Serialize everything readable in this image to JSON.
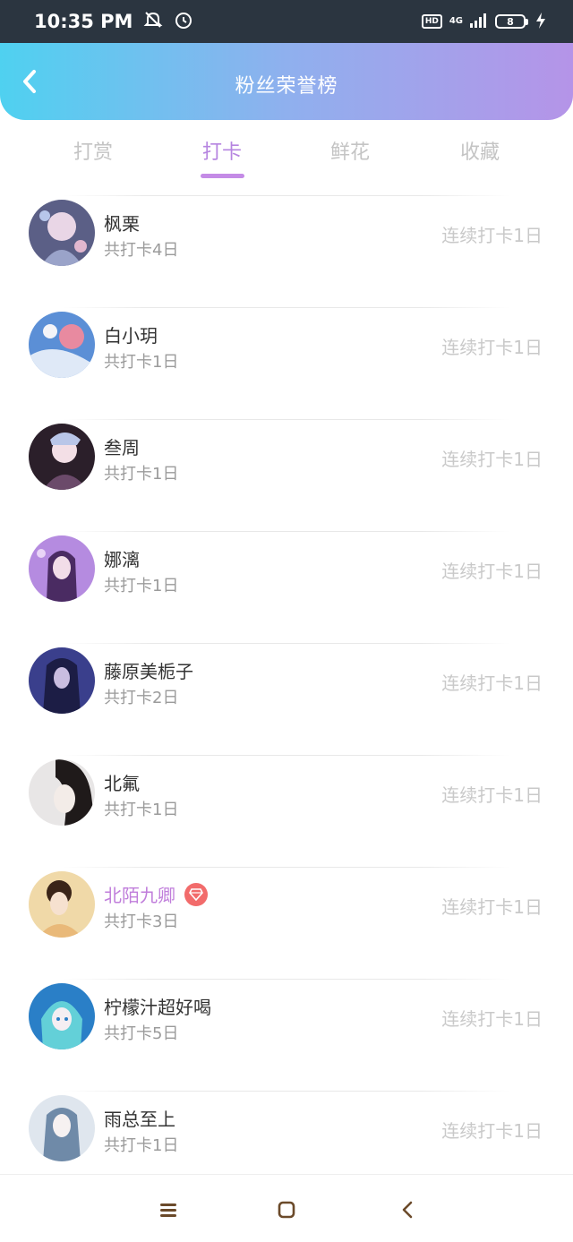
{
  "status_bar": {
    "time": "10:35 PM",
    "hd": "HD",
    "network": "4G",
    "battery": "8",
    "icons": [
      "bell-off-icon",
      "alarm-icon",
      "signal-icon",
      "battery-icon",
      "charging-icon"
    ]
  },
  "header": {
    "title": "粉丝荣誉榜",
    "back_icon": "chevron-left-icon",
    "gradient": [
      "#4fd1f0",
      "#b594e8"
    ]
  },
  "tabs": [
    {
      "label": "打赏",
      "active": false
    },
    {
      "label": "打卡",
      "active": true
    },
    {
      "label": "鲜花",
      "active": false
    },
    {
      "label": "收藏",
      "active": false
    }
  ],
  "accent_color": "#b685e0",
  "fans": [
    {
      "name": "枫栗",
      "total": "共打卡4日",
      "streak": "连续打卡1日",
      "vip": false
    },
    {
      "name": "白小玥",
      "total": "共打卡1日",
      "streak": "连续打卡1日",
      "vip": false
    },
    {
      "name": "叁周",
      "total": "共打卡1日",
      "streak": "连续打卡1日",
      "vip": false
    },
    {
      "name": "娜漓",
      "total": "共打卡1日",
      "streak": "连续打卡1日",
      "vip": false
    },
    {
      "name": "藤原美栀子",
      "total": "共打卡2日",
      "streak": "连续打卡1日",
      "vip": false
    },
    {
      "name": "北氟",
      "total": "共打卡1日",
      "streak": "连续打卡1日",
      "vip": false
    },
    {
      "name": "北陌九卿",
      "total": "共打卡3日",
      "streak": "连续打卡1日",
      "vip": true
    },
    {
      "name": "柠檬汁超好喝",
      "total": "共打卡5日",
      "streak": "连续打卡1日",
      "vip": false
    },
    {
      "name": "雨总至上",
      "total": "共打卡1日",
      "streak": "连续打卡1日",
      "vip": false
    }
  ],
  "nav_bar": {
    "icons": [
      "menu-icon",
      "home-square-icon",
      "back-triangle-icon"
    ]
  }
}
